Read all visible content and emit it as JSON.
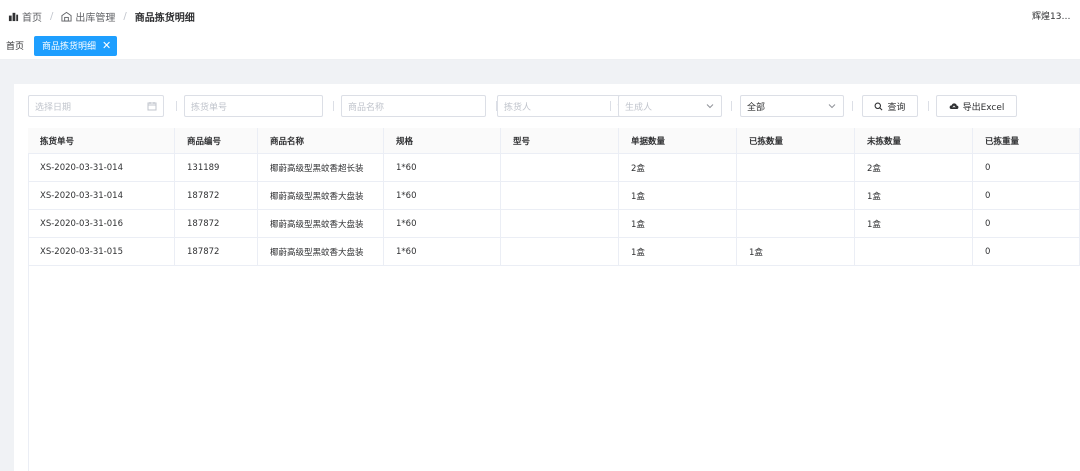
{
  "breadcrumb": {
    "home": "首页",
    "section": "出库管理",
    "current": "商品拣货明细",
    "separator": "/"
  },
  "user": {
    "name": "辉煌132..."
  },
  "tabs": [
    {
      "label": "首页",
      "active": false
    },
    {
      "label": "商品拣货明细",
      "active": true,
      "close": "✕"
    }
  ],
  "filters": {
    "date_placeholder": "选择日期",
    "pick_no_placeholder": "拣货单号",
    "product_name_placeholder": "商品名称",
    "picker_placeholder": "拣货人",
    "creator_placeholder": "生成人",
    "status_value": "全部",
    "query_label": "查询",
    "export_label": "导出Excel"
  },
  "table": {
    "columns": [
      "拣货单号",
      "商品编号",
      "商品名称",
      "规格",
      "型号",
      "单据数量",
      "已拣数量",
      "未拣数量",
      "已拣重量"
    ],
    "rows": [
      [
        "XS-2020-03-31-014",
        "131189",
        "椰蔚高级型黑蚊香超长装",
        "1*60",
        "",
        "2盒",
        "",
        "2盒",
        "0"
      ],
      [
        "XS-2020-03-31-014",
        "187872",
        "椰蔚高级型黑蚊香大盘装",
        "1*60",
        "",
        "1盒",
        "",
        "1盒",
        "0"
      ],
      [
        "XS-2020-03-31-016",
        "187872",
        "椰蔚高级型黑蚊香大盘装",
        "1*60",
        "",
        "1盒",
        "",
        "1盒",
        "0"
      ],
      [
        "XS-2020-03-31-015",
        "187872",
        "椰蔚高级型黑蚊香大盘装",
        "1*60",
        "",
        "1盒",
        "1盒",
        "",
        "0"
      ]
    ]
  },
  "colors": {
    "accent": "#1e9fff",
    "border": "#dcdfe6",
    "page_bg": "#f0f2f5"
  }
}
